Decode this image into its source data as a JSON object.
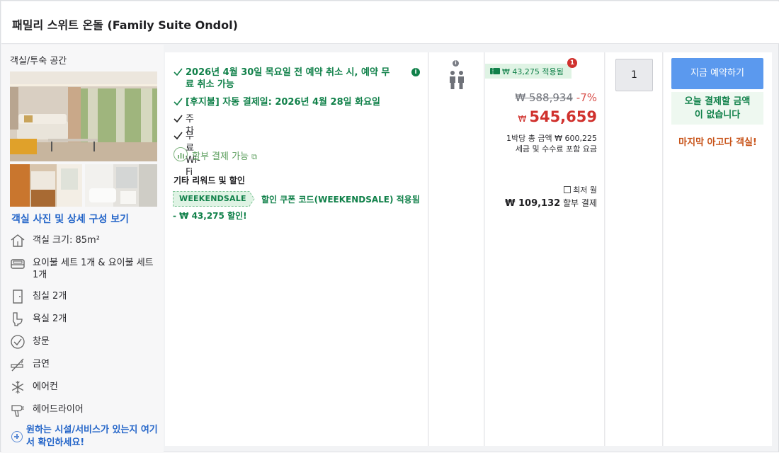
{
  "header": {
    "title": "패밀리 스위트 온돌 (Family Suite Ondol)"
  },
  "room": {
    "category": "객실/투숙 공간",
    "photos_link": "객실 사진 및 상세 구성 보기",
    "amenities": [
      {
        "icon": "house-icon",
        "text": "객실 크기: 85m²"
      },
      {
        "icon": "bed-icon",
        "text": "요이불 세트 1개 & 요이불 세트 1개"
      },
      {
        "icon": "door-icon",
        "text": "침실 2개"
      },
      {
        "icon": "toilet-icon",
        "text": "욕실 2개"
      },
      {
        "icon": "check-circle-icon",
        "text": "창문"
      },
      {
        "icon": "no-smoking-icon",
        "text": "금연"
      },
      {
        "icon": "snowflake-icon",
        "text": "에어컨"
      },
      {
        "icon": "hair-dryer-icon",
        "text": "헤어드라이어"
      }
    ],
    "more_link": "원하는 시설/서비스가 있는지 여기서 확인하세요!"
  },
  "policies": {
    "cancel": "2026년 4월 30일 목요일 전 예약 취소 시, 예약 무료 취소 가능",
    "cancel_line1": "2026년 4월 30일 목요일 전 예약 취소 시, 예약 무",
    "cancel_line2": "료 취소 가능",
    "pay_later": "[후지불] 자동 결제일: 2026년 4월 28일 화요일",
    "parking": "주차",
    "wifi": "무료 Wi-Fi",
    "installment": "할부 결제 가능"
  },
  "rewards": {
    "heading": "기타 리워드 및 할인",
    "coupon_code": "WEEKENDSALE",
    "coupon_applied": "할인 쿠폰 코드(WEEKENDSALE) 적용됨",
    "coupon_discount": "- ₩ 43,275 할인!"
  },
  "price": {
    "coupon_badge": "₩ 43,275 적용됨",
    "badge_count": "1",
    "original": "₩ 588,934",
    "discount_pct": "-7%",
    "currency": "₩",
    "final": "545,659",
    "per_night": "1박당 총 금액 ₩ 600,225",
    "taxes_note": "세금 및 수수료 포함 요금",
    "lowest_monthly_label": "최저 월",
    "monthly_amount": "₩ 109,132",
    "monthly_suffix": "할부 결제"
  },
  "booking": {
    "quantity": "1",
    "book_button": "지금 예약하기",
    "no_pay_today": "오늘 결제할 금액이 없습니다",
    "no_pay_line1": "오늘 결제할 금액",
    "no_pay_line2": "이 없습니다",
    "last_room": "마지막 아고다 객실!"
  },
  "colors": {
    "green": "#11814a",
    "blue_link": "#2566c9",
    "button": "#5b99ee",
    "price_red": "#d0312d",
    "last_room_orange": "#c8541a"
  }
}
